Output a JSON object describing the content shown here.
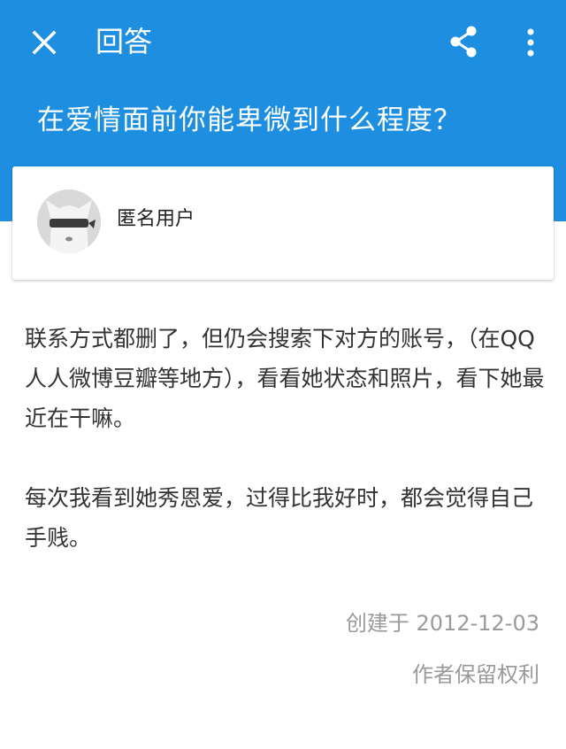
{
  "topbar": {
    "close_icon": "close-icon",
    "title": "回答",
    "share_icon": "share-icon",
    "more_icon": "more-vertical-icon"
  },
  "question": {
    "title": "在爱情面前你能卑微到什么程度？"
  },
  "author": {
    "avatar_icon": "anonymous-avatar",
    "name": "匿名用户"
  },
  "answer": {
    "paragraphs": [
      "联系方式都删了，但仍会搜索下对方的账号，（在QQ人人微博豆瓣等地方），看看她状态和照片，看下她最近在干嘛。",
      "每次我看到她秀恩爱，过得比我好时，都会觉得自己手贱。"
    ]
  },
  "footer": {
    "created": "创建于 2012-12-03",
    "rights": "作者保留权利"
  },
  "colors": {
    "header_bg": "#1e8fe0",
    "header_text": "#ffffff",
    "body_text": "#333333",
    "meta_text": "#9a9a9a"
  }
}
